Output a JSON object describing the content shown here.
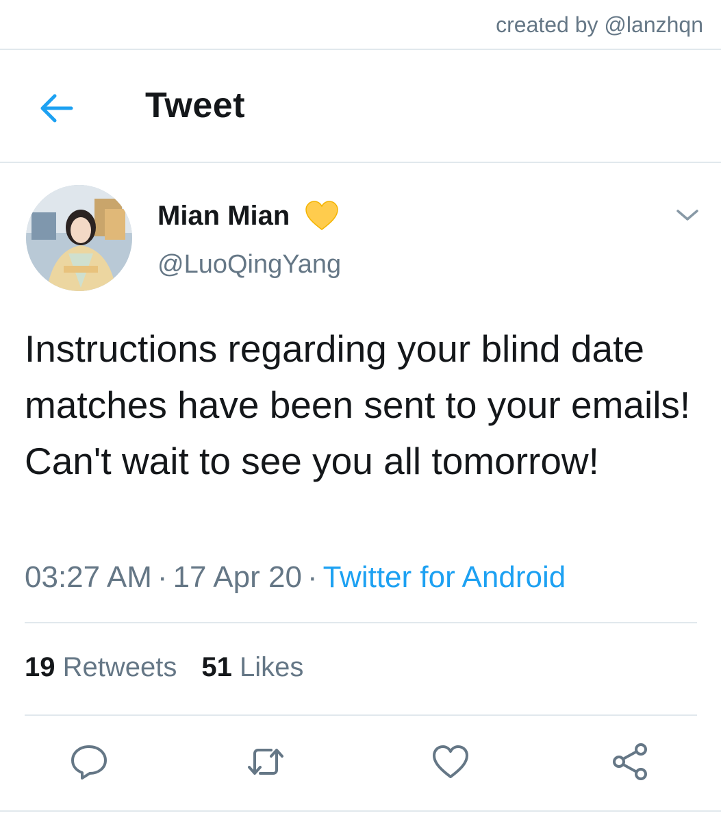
{
  "watermark": "created by @lanzhqn",
  "header": {
    "title": "Tweet",
    "back_icon": "back-arrow-icon"
  },
  "author": {
    "display_name": "Mian Mian",
    "badge_icon": "yellow-heart-icon",
    "handle": "@LuoQingYang"
  },
  "tweet": {
    "text": "Instructions regarding your blind date matches have been sent to your emails! Can't wait to see you all tomorrow!",
    "time": "03:27 AM",
    "date": "17 Apr 20",
    "separator": "·",
    "source": "Twitter for Android"
  },
  "stats": {
    "retweets_count": "19",
    "retweets_label": "Retweets",
    "likes_count": "51",
    "likes_label": "Likes"
  },
  "actions": [
    "reply-icon",
    "retweet-icon",
    "like-icon",
    "share-icon"
  ],
  "colors": {
    "accent": "#1da1f2",
    "secondary_text": "#657786",
    "primary_text": "#14171a",
    "divider": "#e1e8ed",
    "heart": "#ffcc4d"
  }
}
